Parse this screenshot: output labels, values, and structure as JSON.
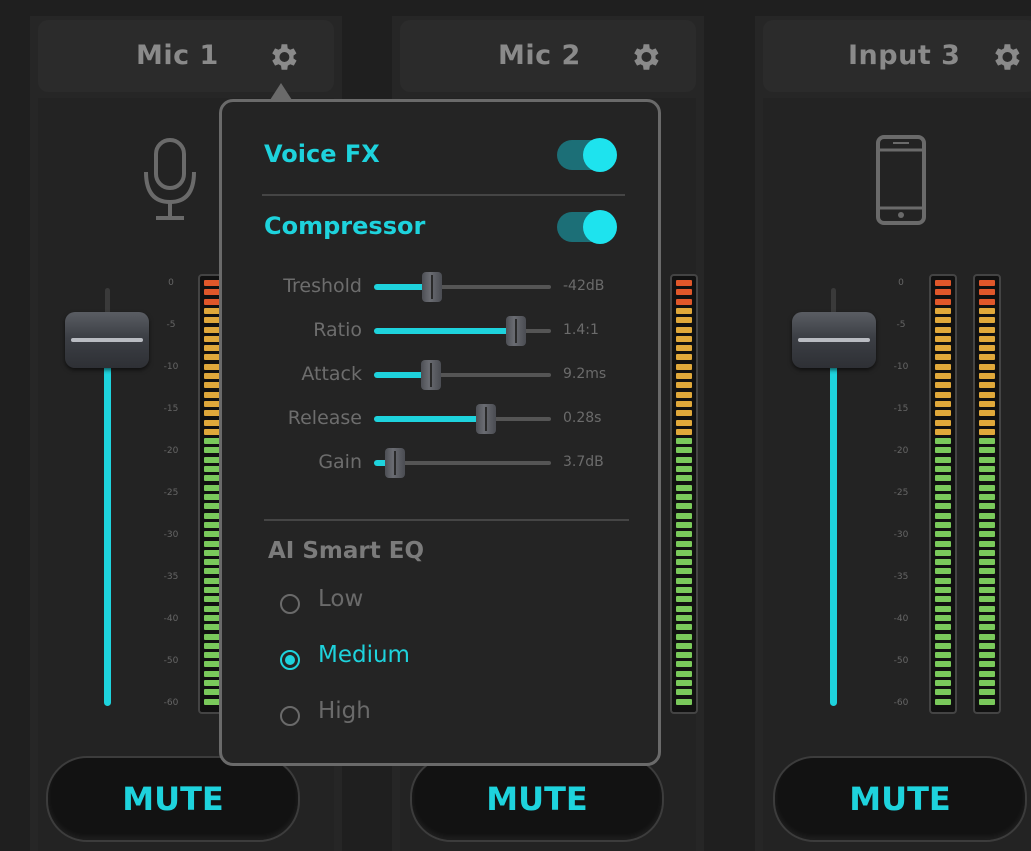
{
  "channels": [
    {
      "title": "Mic 1",
      "mute_label": "MUTE",
      "device_icon": "microphone-icon",
      "meter_scale": [
        "0",
        "-5",
        "-10",
        "-15",
        "-20",
        "-25",
        "-30",
        "-35",
        "-40",
        "-50",
        "-60"
      ]
    },
    {
      "title": "Mic 2",
      "mute_label": "MUTE",
      "device_icon": "microphone-icon"
    },
    {
      "title": "Input 3",
      "mute_label": "MUTE",
      "device_icon": "phone-icon",
      "meter_scale": [
        "0",
        "-5",
        "-10",
        "-15",
        "-20",
        "-25",
        "-30",
        "-35",
        "-40",
        "-50",
        "-60"
      ]
    }
  ],
  "popup": {
    "voice_fx": {
      "label": "Voice FX",
      "enabled": true
    },
    "compressor": {
      "label": "Compressor",
      "enabled": true,
      "params": [
        {
          "label": "Treshold",
          "value": "-42dB",
          "level": 0.33
        },
        {
          "label": "Ratio",
          "value": "1.4:1",
          "level": 0.8
        },
        {
          "label": "Attack",
          "value": "9.2ms",
          "level": 0.32
        },
        {
          "label": "Release",
          "value": "0.28s",
          "level": 0.63
        },
        {
          "label": "Gain",
          "value": "3.7dB",
          "level": 0.12
        }
      ]
    },
    "eq": {
      "title": "AI Smart EQ",
      "options": [
        {
          "label": "Low",
          "selected": false
        },
        {
          "label": "Medium",
          "selected": true
        },
        {
          "label": "High",
          "selected": false
        }
      ]
    }
  },
  "colors": {
    "accent": "#1ed3dd",
    "background": "#1f1f1f",
    "meter_red": "#e0572a",
    "meter_yellow": "#e0a83a",
    "meter_green": "#7ac95b"
  }
}
